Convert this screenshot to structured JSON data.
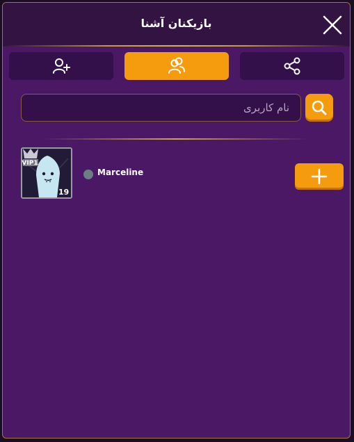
{
  "header": {
    "title": "بازیکنان آشنا",
    "close_icon": "close-icon"
  },
  "tabs": [
    {
      "icon": "add-friend-icon",
      "active": false
    },
    {
      "icon": "friends-group-icon",
      "active": true
    },
    {
      "icon": "share-icon",
      "active": false
    }
  ],
  "search": {
    "placeholder": "نام کاربری",
    "value": "",
    "icon": "search-icon"
  },
  "players": [
    {
      "name": "Marceline",
      "level": "19",
      "vip_label": "VIP1",
      "status": "offline",
      "status_color": "#6b7f83",
      "action_icon": "plus-icon"
    }
  ],
  "colors": {
    "accent": "#f49c0e",
    "panel_bg": "#4b1866",
    "header_bg": "#321341",
    "tab_bg": "#33104a",
    "border": "#a8782a"
  }
}
